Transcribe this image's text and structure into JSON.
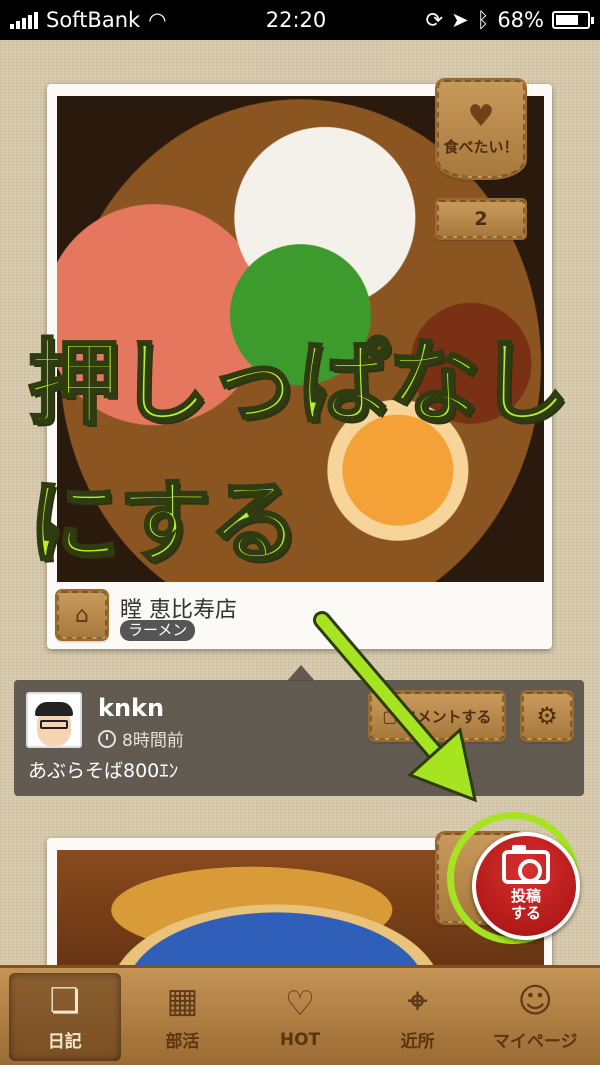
{
  "status_bar": {
    "carrier": "SoftBank",
    "time": "22:20",
    "battery": "68%"
  },
  "post": {
    "want_label": "食べたい！",
    "want_count": "2",
    "shop_name": "瞠 恵比寿店",
    "genre": "ラーメン",
    "overlay_line1": "押しっぱなし",
    "overlay_line2": "にする"
  },
  "comment": {
    "user": "knkn",
    "time_ago": "8時間前",
    "text": "あぶらそば800ｴﾝ",
    "comment_button": "コメントする"
  },
  "post_button": {
    "line1": "投稿",
    "line2": "する"
  },
  "tabbar": {
    "tabs": [
      {
        "label": "日記",
        "icon": "diary-book-icon",
        "active": true
      },
      {
        "label": "部活",
        "icon": "buildings-icon",
        "active": false
      },
      {
        "label": "HOT",
        "icon": "hearts-icon",
        "active": false
      },
      {
        "label": "近所",
        "icon": "map-pin-icon",
        "active": false
      },
      {
        "label": "マイページ",
        "icon": "face-icon",
        "active": false
      }
    ]
  },
  "colors": {
    "accent_green": "#a6e321",
    "post_red": "#c01d1c",
    "leather": "#b5874a"
  }
}
